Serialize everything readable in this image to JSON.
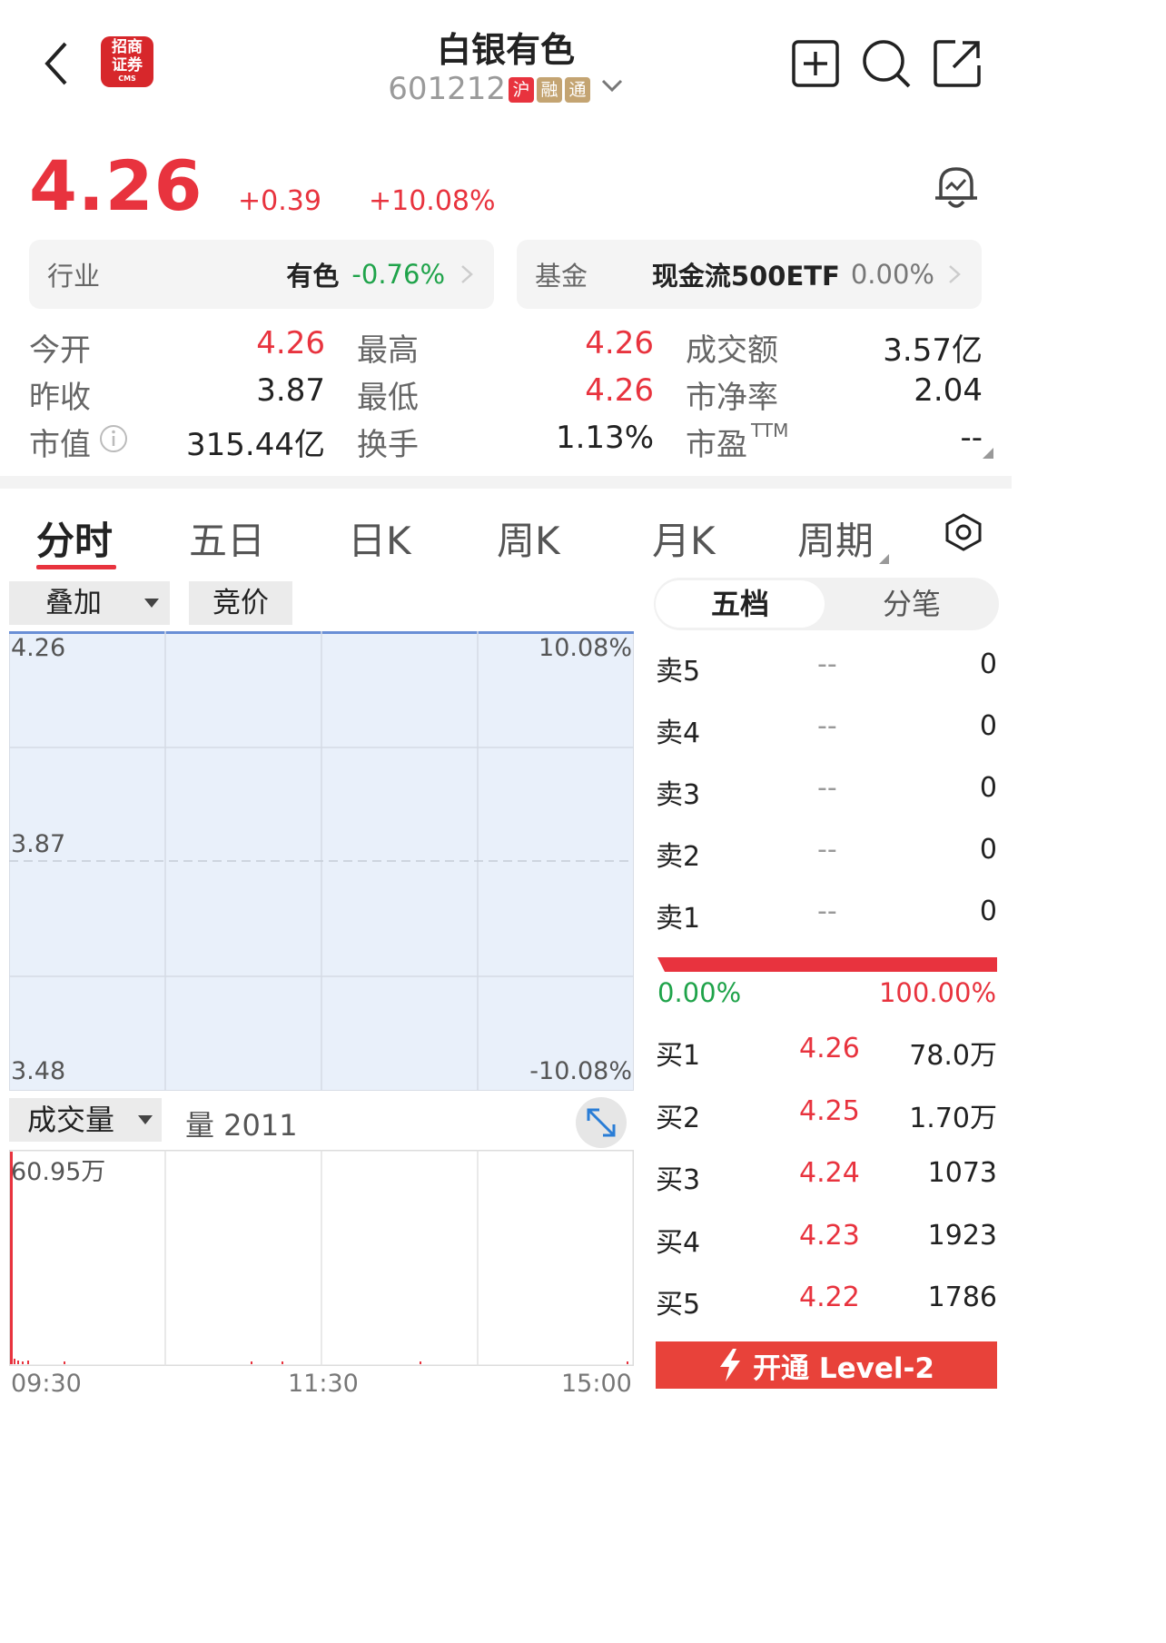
{
  "header": {
    "title": "白银有色",
    "code": "601212",
    "tags": [
      {
        "text": "沪",
        "color": "#e8333e"
      },
      {
        "text": "融",
        "color": "#c4a472"
      },
      {
        "text": "通",
        "color": "#c4a472"
      }
    ],
    "logo_text_1": "招商",
    "logo_text_2": "证券",
    "logo_sub": "CMS"
  },
  "quote": {
    "price": "4.26",
    "change": "+0.39",
    "change_pct": "+10.08%"
  },
  "industry": {
    "label": "行业",
    "name": "有色",
    "pct": "-0.76%"
  },
  "fund": {
    "label": "基金",
    "name": "现金流500ETF",
    "pct": "0.00%"
  },
  "stats": [
    {
      "l1": "今开",
      "v1": "4.26",
      "l2": "最高",
      "v2": "4.26",
      "l3": "成交额",
      "v3": "3.57亿"
    },
    {
      "l1": "昨收",
      "v1": "3.87",
      "l2": "最低",
      "v2": "4.26",
      "l3": "市净率",
      "v3": "2.04"
    },
    {
      "l1": "市值",
      "v1": "315.44亿",
      "l2": "换手",
      "v2": "1.13%",
      "l3": "市盈",
      "l3sup": "TTM",
      "v3": "--"
    }
  ],
  "tabs": [
    "分时",
    "五日",
    "日K",
    "周K",
    "月K",
    "周期"
  ],
  "chart": {
    "overlay_label": "叠加",
    "auction_label": "竞价",
    "y_top": "4.26",
    "y_mid": "3.87",
    "y_bot": "3.48",
    "pct_top": "10.08%",
    "pct_bot": "-10.08%",
    "volume_label": "成交量",
    "volume_value": "量 2011",
    "vol_max": "60.95万",
    "x_labels": [
      "09:30",
      "11:30",
      "15:00"
    ]
  },
  "orderbook": {
    "tab_active": "五档",
    "tab_other": "分笔",
    "asks": [
      {
        "label": "卖5",
        "price": "--",
        "vol": "0"
      },
      {
        "label": "卖4",
        "price": "--",
        "vol": "0"
      },
      {
        "label": "卖3",
        "price": "--",
        "vol": "0"
      },
      {
        "label": "卖2",
        "price": "--",
        "vol": "0"
      },
      {
        "label": "卖1",
        "price": "--",
        "vol": "0"
      }
    ],
    "ratio_left": "0.00%",
    "ratio_right": "100.00%",
    "bids": [
      {
        "label": "买1",
        "price": "4.26",
        "vol": "78.0万"
      },
      {
        "label": "买2",
        "price": "4.25",
        "vol": "1.70万"
      },
      {
        "label": "买3",
        "price": "4.24",
        "vol": "1073"
      },
      {
        "label": "买4",
        "price": "4.23",
        "vol": "1923"
      },
      {
        "label": "买5",
        "price": "4.22",
        "vol": "1786"
      }
    ],
    "level2_label": "开通 Level-2"
  },
  "colors": {
    "up": "#e8333e",
    "down": "#1fa34a",
    "level2": "#e8423a"
  }
}
